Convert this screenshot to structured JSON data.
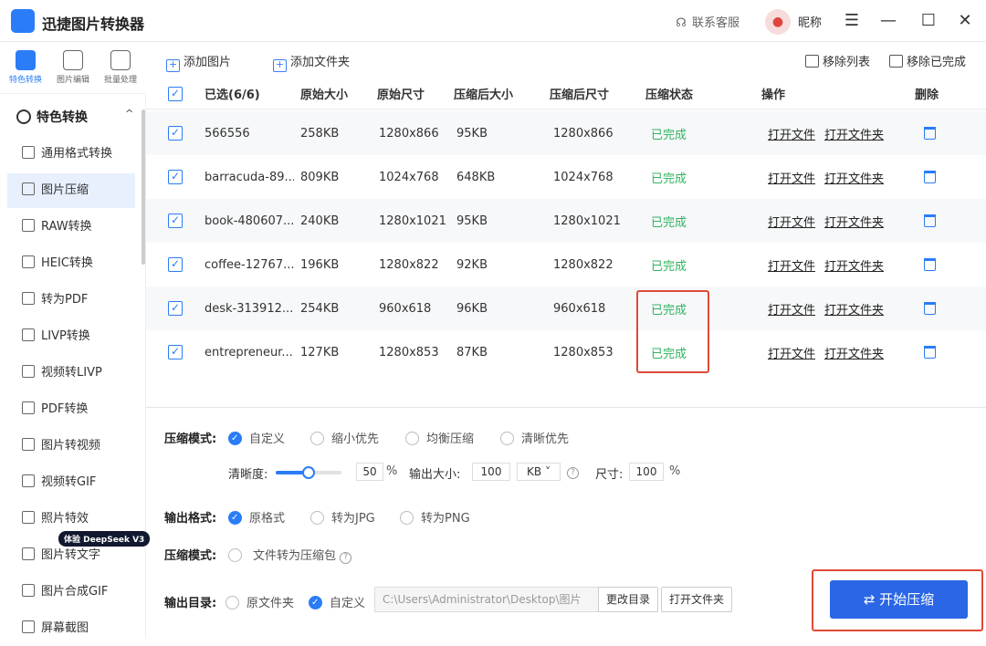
{
  "app": {
    "title": "迅捷图片转换器",
    "support": "联系客服",
    "nickname": "昵称"
  },
  "window_controls": {
    "menu": "☰",
    "minimize": "—",
    "maximize": "☐",
    "close": "✕"
  },
  "icon_tabs": [
    {
      "label": "特色转换"
    },
    {
      "label": "图片编辑"
    },
    {
      "label": "批量处理"
    }
  ],
  "sidebar": {
    "section": "特色转换",
    "caret": "^",
    "items": [
      {
        "label": "通用格式转换"
      },
      {
        "label": "图片压缩"
      },
      {
        "label": "RAW转换"
      },
      {
        "label": "HEIC转换"
      },
      {
        "label": "转为PDF"
      },
      {
        "label": "LIVP转换"
      },
      {
        "label": "视频转LIVP"
      },
      {
        "label": "PDF转换"
      },
      {
        "label": "图片转视频"
      },
      {
        "label": "视频转GIF"
      },
      {
        "label": "照片特效"
      },
      {
        "label": "图片转文字"
      },
      {
        "label": "图片合成GIF"
      },
      {
        "label": "屏幕截图"
      }
    ],
    "badge": "体验 DeepSeek V3"
  },
  "toolbar": {
    "add_image": "添加图片",
    "add_folder": "添加文件夹",
    "remove_list": "移除列表",
    "remove_done": "移除已完成"
  },
  "table": {
    "headers": {
      "selected": "已选(6/6)",
      "orig_size": "原始大小",
      "orig_dim": "原始尺寸",
      "comp_size": "压缩后大小",
      "comp_dim": "压缩后尺寸",
      "status": "压缩状态",
      "ops": "操作",
      "delete": "删除"
    },
    "rows": [
      {
        "name": "566556",
        "orig_size": "258KB",
        "orig_dim": "1280x866",
        "comp_size": "95KB",
        "comp_dim": "1280x866",
        "status": "已完成",
        "open_file": "打开文件",
        "open_folder": "打开文件夹"
      },
      {
        "name": "barracuda-89...",
        "orig_size": "809KB",
        "orig_dim": "1024x768",
        "comp_size": "648KB",
        "comp_dim": "1024x768",
        "status": "已完成",
        "open_file": "打开文件",
        "open_folder": "打开文件夹"
      },
      {
        "name": "book-480607...",
        "orig_size": "240KB",
        "orig_dim": "1280x1021",
        "comp_size": "95KB",
        "comp_dim": "1280x1021",
        "status": "已完成",
        "open_file": "打开文件",
        "open_folder": "打开文件夹"
      },
      {
        "name": "coffee-12767...",
        "orig_size": "196KB",
        "orig_dim": "1280x822",
        "comp_size": "92KB",
        "comp_dim": "1280x822",
        "status": "已完成",
        "open_file": "打开文件",
        "open_folder": "打开文件夹"
      },
      {
        "name": "desk-313912...",
        "orig_size": "254KB",
        "orig_dim": "960x618",
        "comp_size": "96KB",
        "comp_dim": "960x618",
        "status": "已完成",
        "open_file": "打开文件",
        "open_folder": "打开文件夹"
      },
      {
        "name": "entrepreneur...",
        "orig_size": "127KB",
        "orig_dim": "1280x853",
        "comp_size": "87KB",
        "comp_dim": "1280x853",
        "status": "已完成",
        "open_file": "打开文件",
        "open_folder": "打开文件夹"
      }
    ]
  },
  "settings": {
    "mode_label": "压缩模式:",
    "modes": [
      "自定义",
      "缩小优先",
      "均衡压缩",
      "清晰优先"
    ],
    "clarity_label": "清晰度:",
    "clarity_value": "50",
    "clarity_level": 0.5,
    "percent": "%",
    "output_size_label": "输出大小:",
    "output_size_value": "100",
    "output_size_unit": "KB",
    "dimension_label": "尺寸:",
    "dimension_value": "100",
    "format_label": "输出格式:",
    "formats": [
      "原格式",
      "转为JPG",
      "转为PNG"
    ],
    "zip_label": "压缩模式:",
    "zip_option": "文件转为压缩包",
    "dir_label": "输出目录:",
    "dir_options": [
      "原文件夹",
      "自定义"
    ],
    "dir_path": "C:\\Users\\Administrator\\Desktop\\图片",
    "change_dir": "更改目录",
    "open_folder": "打开文件夹",
    "start": "开始压缩"
  },
  "colors": {
    "accent": "#2a7cf7",
    "done": "#2fb35e",
    "highlight": "#e04a36"
  }
}
